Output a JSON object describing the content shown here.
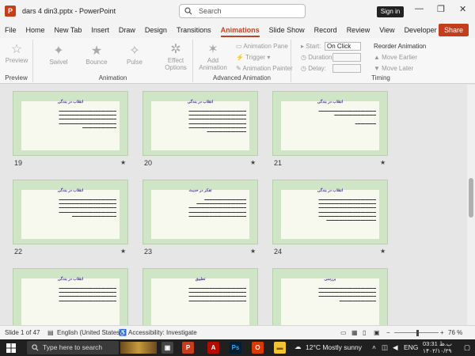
{
  "window": {
    "title": "dars 4 din3.pptx  -  PowerPoint",
    "search_placeholder": "Search",
    "signin_label": "Sign in",
    "share_label": "Share",
    "minimize": "—",
    "restore": "❐",
    "close": "✕"
  },
  "menu": {
    "items": [
      "File",
      "Home",
      "New Tab",
      "Insert",
      "Draw",
      "Design",
      "Transitions",
      "Animations",
      "Slide Show",
      "Record",
      "Review",
      "View",
      "Developer"
    ],
    "active": "Animations"
  },
  "ribbon": {
    "preview": {
      "label": "Preview",
      "group": "Preview"
    },
    "animations": {
      "swivel": "Swivel",
      "bounce": "Bounce",
      "pulse": "Pulse",
      "effect_options": "Effect Options",
      "group": "Animation"
    },
    "advanced": {
      "add_animation": "Add Animation",
      "animation_pane": "Animation Pane",
      "trigger": "Trigger",
      "animation_painter": "Animation Painter",
      "group": "Advanced Animation"
    },
    "timing": {
      "start_label": "Start:",
      "start_value": "On Click",
      "duration_label": "Duration:",
      "duration_value": "",
      "delay_label": "Delay:",
      "delay_value": "",
      "reorder_label": "Reorder Animation",
      "move_earlier": "Move Earlier",
      "move_later": "Move Later",
      "group": "Timing"
    }
  },
  "slides": [
    {
      "number": "19",
      "title": "انقلاب در بندگی"
    },
    {
      "number": "20",
      "title": "انقلاب در بندگی"
    },
    {
      "number": "21",
      "title": "انقلاب در بندگی"
    },
    {
      "number": "22",
      "title": "انقلاب در بندگی"
    },
    {
      "number": "23",
      "title": "تفکر در حدیث"
    },
    {
      "number": "24",
      "title": "انقلاب در بندگی"
    },
    {
      "number": "",
      "title": "انقلاب در بندگی"
    },
    {
      "number": "",
      "title": "تطبیق"
    },
    {
      "number": "",
      "title": "بررسی"
    }
  ],
  "slide_star": "★",
  "status": {
    "slide_of": "Slide 1 of 47",
    "language": "English (United States)",
    "accessibility": "Accessibility: Investigate",
    "zoom": "76 %"
  },
  "taskbar": {
    "search_placeholder": "Type here to search",
    "weather": "12°C  Mostly sunny",
    "time": "03:31 ب.ظ",
    "date": "۱۴۰۲/۱۰/۲۹",
    "lang": "ENG"
  }
}
